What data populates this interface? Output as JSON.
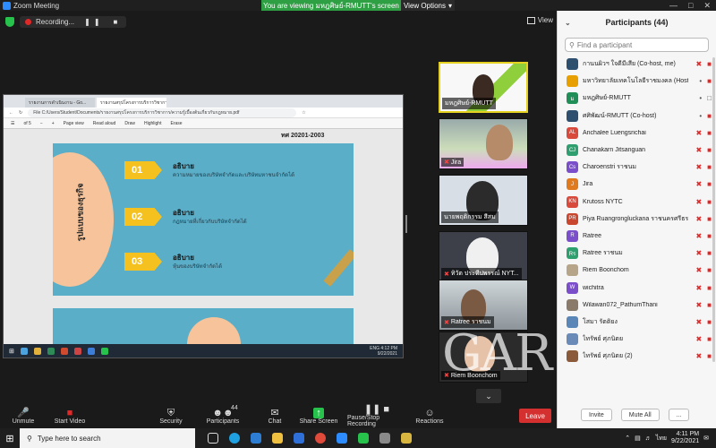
{
  "window": {
    "title": "Zoom Meeting"
  },
  "banner": {
    "viewing": "You are viewing มหฎศิษย์-RMUTT's screen",
    "view_options": "View Options"
  },
  "recording": {
    "label": "Recording...",
    "pause": "❚❚",
    "stop": "■"
  },
  "view_button": "View",
  "shared_screen": {
    "tabs": [
      "รายงานการดำเนินงาน - Go...",
      "รายงานสรุปโครงการบริการวิชาการ..."
    ],
    "url": "File  C:/Users/Student/Documents/รายงานสรุปโครงการบริการวิชาการ/ความรู้เบื้องต้นเกี่ยวกับกฎหมาย.pdf",
    "page_indicator": "of 5",
    "pdf_tools": [
      "Read aloud",
      "Page view",
      "Draw",
      "Highlight",
      "Erase"
    ],
    "header_text": "ทศ 20201-2003",
    "slide_vertical": "รูปแบบของธุรกิจ",
    "items": [
      {
        "num": "01",
        "title": "อธิบาย",
        "desc": "ความหมายของบริษัทจำกัดและบริษัทมหาชนจำกัดได้"
      },
      {
        "num": "02",
        "title": "อธิบาย",
        "desc": "กฎหมายที่เกี่ยวกับบริษัทจำกัดได้"
      },
      {
        "num": "03",
        "title": "อธิบาย",
        "desc": "หุ้นของบริษัทจำกัดได้"
      }
    ],
    "taskbar_time": "4:12 PM",
    "taskbar_date": "9/22/2021",
    "taskbar_lang": "ENG"
  },
  "tiles": [
    {
      "name": "มหฎศิษย์-RMUTT",
      "muted": false
    },
    {
      "name": "Jira",
      "muted": true
    },
    {
      "name": "นายพฤติกรรม สีสม",
      "muted": false
    },
    {
      "name": "ทิวัต ประทีปพรรณ์ NYT...",
      "muted": true
    },
    {
      "name": "Ratree ราชนม",
      "muted": true
    },
    {
      "name": "Riem Boonchom",
      "muted": true
    }
  ],
  "toolbar": {
    "unmute": "Unmute",
    "start_video": "Start Video",
    "security": "Security",
    "participants": "Participants",
    "participants_count": "44",
    "chat": "Chat",
    "share_screen": "Share Screen",
    "pause_recording": "Pause/Stop Recording",
    "reactions": "Reactions",
    "end": "Leave"
  },
  "watermark": "GAR",
  "panel": {
    "title": "Participants (44)",
    "search_placeholder": "Find a participant",
    "participants": [
      {
        "name": "กานนผิวฯ ใจดีมีเสีย (Co-host, me)",
        "initials": "",
        "color": "#2f4f6f",
        "mic": "off",
        "cam": "off"
      },
      {
        "name": "มหาวิทยาลัยเทคโนโลยีราชมงคล (Host)",
        "initials": "",
        "color": "#e8a000",
        "mic": "on",
        "cam": "off"
      },
      {
        "name": "มหฎศิษย์-RMUTT",
        "initials": "ม",
        "color": "#1f8f57",
        "mic": "on",
        "cam": "on"
      },
      {
        "name": "ศศิพัฒน์-RMUTT (Co-host)",
        "initials": "",
        "color": "#2f4f6f",
        "mic": "on",
        "cam": "off"
      },
      {
        "name": "Anchalee Luengsrichai",
        "initials": "AL",
        "color": "#d84a3c",
        "mic": "off",
        "cam": "off"
      },
      {
        "name": "Chanakarn Jitsanguan",
        "initials": "CJ",
        "color": "#2f9f6f",
        "mic": "off",
        "cam": "off"
      },
      {
        "name": "Charoenstri ราชนม",
        "initials": "Cs",
        "color": "#7a4fc9",
        "mic": "off",
        "cam": "off"
      },
      {
        "name": "Jira",
        "initials": "J",
        "color": "#e07a1f",
        "mic": "off",
        "cam": "off"
      },
      {
        "name": "Krutoss NYTC",
        "initials": "KN",
        "color": "#d84a3c",
        "mic": "off",
        "cam": "off"
      },
      {
        "name": "Piya Ruangrongluckana ราชนครศรีธรรม",
        "initials": "PR",
        "color": "#c9462f",
        "mic": "off",
        "cam": "off"
      },
      {
        "name": "Ratree",
        "initials": "R",
        "color": "#7a4fc9",
        "mic": "off",
        "cam": "off"
      },
      {
        "name": "Ratree ราชนม",
        "initials": "Rร",
        "color": "#2f9f6f",
        "mic": "off",
        "cam": "off"
      },
      {
        "name": "Riem Boonchom",
        "initials": "",
        "color": "#b7a58a",
        "mic": "off",
        "cam": "off"
      },
      {
        "name": "wichitra",
        "initials": "W",
        "color": "#7a4fc9",
        "mic": "off",
        "cam": "off"
      },
      {
        "name": "Wilawan072_PathumThani",
        "initials": "",
        "color": "#8a7a6a",
        "mic": "off",
        "cam": "off"
      },
      {
        "name": "โสมา รัตติยง",
        "initials": "",
        "color": "#5a86b8",
        "mic": "off",
        "cam": "off"
      },
      {
        "name": "ไทรัพย์ ศุภนิตย",
        "initials": "",
        "color": "#6a8ab8",
        "mic": "off",
        "cam": "off"
      },
      {
        "name": "ไทรัพย์ ศุภนิตย (2)",
        "initials": "",
        "color": "#8a5a3a",
        "mic": "off",
        "cam": "off"
      }
    ],
    "invite": "Invite",
    "mute_all": "Mute All",
    "more": "..."
  },
  "taskbar": {
    "search_placeholder": "Type here to search",
    "time": "4:11 PM",
    "date": "9/22/2021",
    "lang": "ไทย"
  }
}
